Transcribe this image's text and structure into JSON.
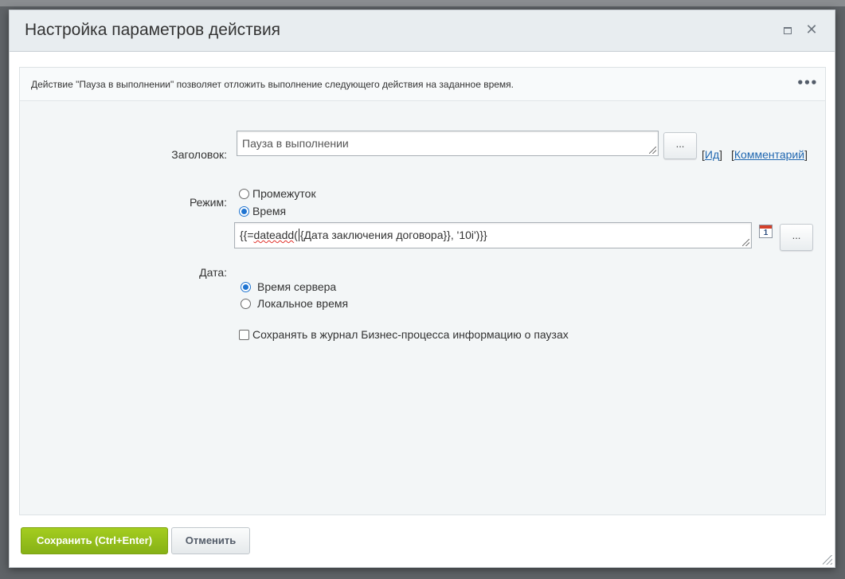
{
  "dialog": {
    "title": "Настройка параметров действия",
    "maximize_icon": "maximize-icon",
    "close_glyph": "✕"
  },
  "description": {
    "text": "Действие \"Пауза в выполнении\" позволяет отложить выполнение следующего действия на заданное время.",
    "more_glyph": "•••"
  },
  "form": {
    "title_label": "Заголовок:",
    "title_value": "Пауза в выполнении",
    "dots_label": "...",
    "link_id": "Ид",
    "link_comment": "Комментарий",
    "bracket_open": "[",
    "bracket_close": "]",
    "mode_label": "Режим:",
    "mode_options": [
      "Промежуток",
      "Время"
    ],
    "mode_selected": "Время",
    "date_label": "Дата:",
    "date_value_prefix": "{{=",
    "date_value_func": "dateadd",
    "date_value_paren": "(",
    "date_value_rest": "{Дата заключения договора}}, '10i')}}",
    "calendar_day": "1",
    "timezone_options": [
      "Время сервера",
      "Локальное время"
    ],
    "timezone_selected": "Время сервера",
    "log_checkbox_label": "Сохранять в журнал Бизнес-процесса информацию о паузах",
    "log_checked": false
  },
  "footer": {
    "save_label": "Сохранить (Ctrl+Enter)",
    "cancel_label": "Отменить"
  },
  "colors": {
    "save_button": "#94c11a",
    "link": "#2067b0",
    "radio_selected": "#1f74d1"
  }
}
